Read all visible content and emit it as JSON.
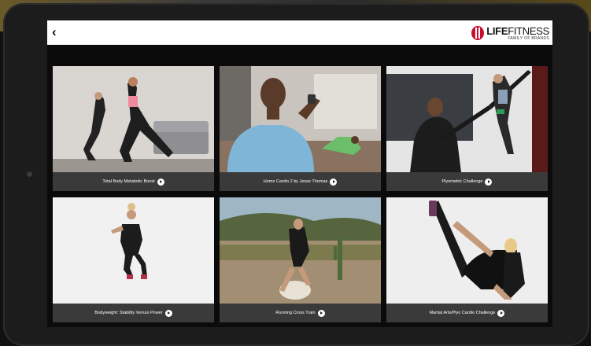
{
  "header": {
    "back_icon": "chevron-left-icon",
    "brand_name_bold": "LIFE",
    "brand_name_rest": "FITNESS",
    "brand_tagline": "FAMILY OF BRANDS",
    "brand_color": "#c8102e"
  },
  "workouts": [
    {
      "title": "Total Body Metabolic Boost"
    },
    {
      "title": "Home Cardio 2 by Jesse Thomas"
    },
    {
      "title": "Plyometric Challenge"
    },
    {
      "title": "Bodyweight: Stability Versus Power"
    },
    {
      "title": "Running Cross Train"
    },
    {
      "title": "Martial Arts/Plyo Cardio Challenge"
    }
  ]
}
